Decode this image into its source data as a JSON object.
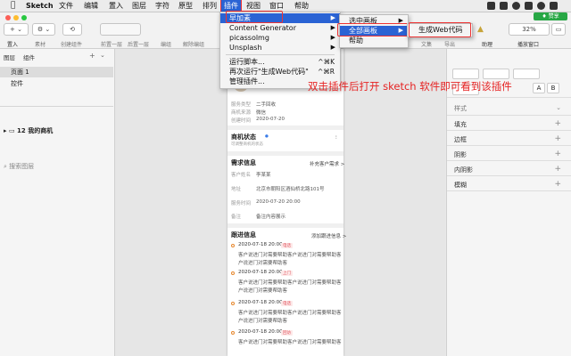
{
  "menubar": {
    "app": "Sketch",
    "items": [
      "文件",
      "编辑",
      "置入",
      "图层",
      "字符",
      "原型",
      "排列",
      "插件",
      "视图",
      "窗口",
      "帮助"
    ]
  },
  "badge": "♦ 赞享",
  "toolbar": {
    "buttons": [
      "+ ⌄",
      "⚙ ⌄",
      "⟲"
    ],
    "labels": [
      "置入",
      "素材",
      "创建组件",
      "前置一层",
      "后置一层",
      "编组",
      "解除编组",
      "缩放",
      "文集",
      "导出",
      "助理",
      "播放窗口"
    ],
    "zoom": "32%"
  },
  "left_panel": {
    "tabs": [
      "图层",
      "组件"
    ],
    "pages": [
      "页面 1",
      "控件"
    ],
    "search_placeholder": "搜索图层",
    "layer": "12 我的商机"
  },
  "artboard": {
    "fields1": [
      {
        "label": "服务类型",
        "value": "二手回收"
      },
      {
        "label": "商机来源",
        "value": "微信"
      },
      {
        "label": "创建时间",
        "value": "2020-07-20"
      }
    ],
    "status_title": "商机状态",
    "status_sub": "可调整商机的状态",
    "demand_title": "需求信息",
    "demand_link": "补充客户需求 >",
    "demand_fields": [
      {
        "label": "客户姓名",
        "value": "李某某"
      },
      {
        "label": "地址",
        "value": "北京市朝阳区酒仙桥北路101号"
      },
      {
        "label": "服务时间",
        "value": "2020-07-20 20:00"
      },
      {
        "label": "备注",
        "value": "备注内容展示"
      }
    ],
    "follow_title": "跟进信息",
    "follow_link": "添加跟进信息 >",
    "follow_items": [
      {
        "time": "2020-07-18 20:00",
        "tag": "电话",
        "lines": [
          "客户说进门对需要帮助客户说进门对需要帮助客",
          "户说进门对需要帮助客"
        ]
      },
      {
        "time": "2020-07-18 20:00",
        "tag": "上门",
        "lines": [
          "客户说进门对需要帮助客户说进门对需要帮助客",
          "户说进门对需要帮助客"
        ]
      },
      {
        "time": "2020-07-18 20:00",
        "tag": "电话",
        "lines": [
          "客户说进门对需要帮助客户说进门对需要帮助客",
          "户说进门对需要帮助客"
        ]
      },
      {
        "time": "2020-07-18 20:00",
        "tag": "回访",
        "lines": [
          "客户说进门对需要帮助客户说进门对需要帮助客"
        ]
      }
    ]
  },
  "right_panel": {
    "sections": [
      "样式",
      "填充",
      "边框",
      "阴影",
      "内阴影",
      "模糊"
    ]
  },
  "plugin_menu": {
    "items": [
      "早加素",
      "Content Generator",
      "picassolmg",
      "Unsplash",
      "运行脚本...",
      "再次运行\"生成Web代码\"",
      "管理插件..."
    ],
    "shortcuts": [
      "^⌘K",
      "^⌘R"
    ]
  },
  "submenu1": {
    "items": [
      "选中画板",
      "全部画板",
      "帮助"
    ]
  },
  "submenu2": {
    "items": [
      "生成Web代码"
    ]
  },
  "annotation": "双击插件后打开 sketch 软件即可看到该插件"
}
